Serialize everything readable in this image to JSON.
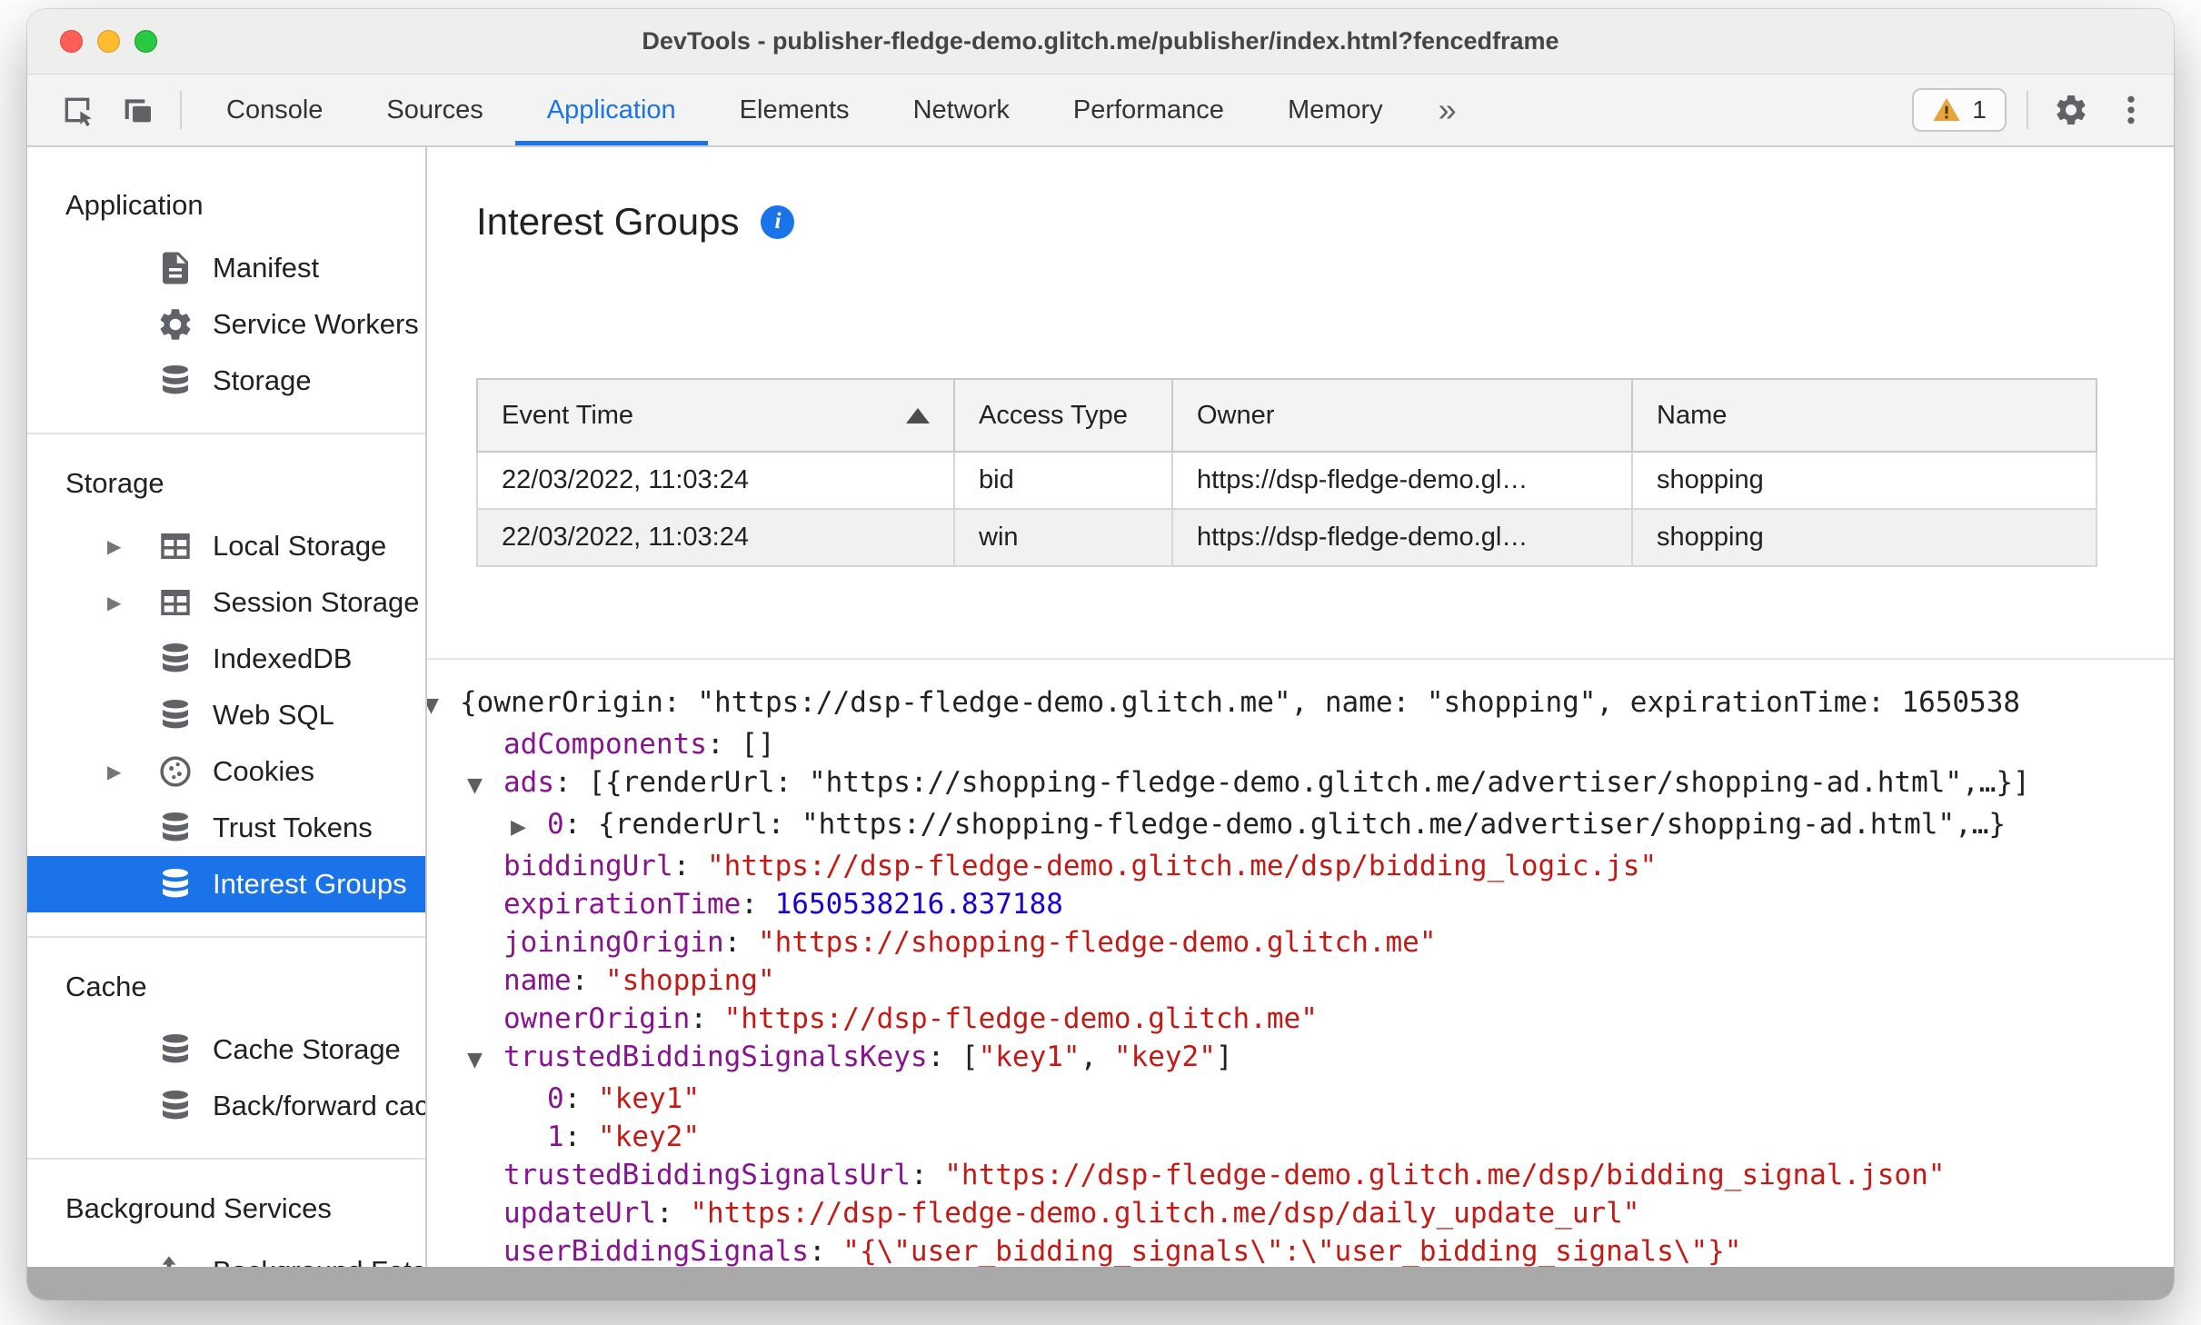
{
  "colors": {
    "accent": "#1a73e8",
    "selected_item_bg": "#1a73e8",
    "tree_key": "#881391",
    "tree_string": "#c41a16",
    "tree_number": "#1c00cf",
    "warning": "#e8a33d"
  },
  "window": {
    "title": "DevTools - publisher-fledge-demo.glitch.me/publisher/index.html?fencedframe"
  },
  "toolbar": {
    "inspect_icon": "inspect-element-icon",
    "device_icon": "device-toolbar-icon",
    "tabs": [
      {
        "label": "Console",
        "active": false
      },
      {
        "label": "Sources",
        "active": false
      },
      {
        "label": "Application",
        "active": true
      },
      {
        "label": "Elements",
        "active": false
      },
      {
        "label": "Network",
        "active": false
      },
      {
        "label": "Performance",
        "active": false
      },
      {
        "label": "Memory",
        "active": false
      }
    ],
    "more_tabs_label": "»",
    "issues_count": "1",
    "settings_icon": "gear-icon",
    "menu_icon": "kebab-menu-icon"
  },
  "sidebar": {
    "sections": [
      {
        "title": "Application",
        "items": [
          {
            "label": "Manifest",
            "icon": "document-icon",
            "expandable": false,
            "selected": false
          },
          {
            "label": "Service Workers",
            "icon": "gear-icon",
            "expandable": false,
            "selected": false
          },
          {
            "label": "Storage",
            "icon": "database-icon",
            "expandable": false,
            "selected": false
          }
        ]
      },
      {
        "title": "Storage",
        "items": [
          {
            "label": "Local Storage",
            "icon": "table-icon",
            "expandable": true,
            "selected": false
          },
          {
            "label": "Session Storage",
            "icon": "table-icon",
            "expandable": true,
            "selected": false
          },
          {
            "label": "IndexedDB",
            "icon": "database-icon",
            "expandable": false,
            "selected": false
          },
          {
            "label": "Web SQL",
            "icon": "database-icon",
            "expandable": false,
            "selected": false
          },
          {
            "label": "Cookies",
            "icon": "cookie-icon",
            "expandable": true,
            "selected": false
          },
          {
            "label": "Trust Tokens",
            "icon": "database-icon",
            "expandable": false,
            "selected": false
          },
          {
            "label": "Interest Groups",
            "icon": "database-icon",
            "expandable": false,
            "selected": true
          }
        ]
      },
      {
        "title": "Cache",
        "items": [
          {
            "label": "Cache Storage",
            "icon": "database-icon",
            "expandable": false,
            "selected": false
          },
          {
            "label": "Back/forward cach",
            "icon": "database-icon",
            "expandable": false,
            "selected": false
          }
        ]
      },
      {
        "title": "Background Services",
        "items": [
          {
            "label": "Background Fetch",
            "icon": "background-fetch-icon",
            "expandable": false,
            "selected": false
          }
        ]
      }
    ]
  },
  "main": {
    "title": "Interest Groups",
    "info_icon": "info-icon",
    "table": {
      "columns": [
        {
          "label": "Event Time",
          "sort": "asc"
        },
        {
          "label": "Access Type",
          "sort": null
        },
        {
          "label": "Owner",
          "sort": null
        },
        {
          "label": "Name",
          "sort": null
        }
      ],
      "rows": [
        [
          "22/03/2022, 11:03:24",
          "bid",
          "https://dsp-fledge-demo.gl…",
          "shopping"
        ],
        [
          "22/03/2022, 11:03:24",
          "win",
          "https://dsp-fledge-demo.gl…",
          "shopping"
        ]
      ]
    },
    "tree": {
      "lines": [
        {
          "indent": 0,
          "expander": "open",
          "segments": [
            {
              "c": "plain",
              "t": "{ownerOrigin: \"https://dsp-fledge-demo.glitch.me\", name: \"shopping\", expirationTime: 1650538"
            }
          ]
        },
        {
          "indent": 1,
          "expander": "none",
          "segments": [
            {
              "c": "key",
              "t": "adComponents"
            },
            {
              "c": "plain",
              "t": ": []"
            }
          ]
        },
        {
          "indent": 1,
          "expander": "open",
          "segments": [
            {
              "c": "key",
              "t": "ads"
            },
            {
              "c": "plain",
              "t": ": [{renderUrl: \"https://shopping-fledge-demo.glitch.me/advertiser/shopping-ad.html\",…}]"
            }
          ]
        },
        {
          "indent": 2,
          "expander": "closed",
          "segments": [
            {
              "c": "key",
              "t": "0"
            },
            {
              "c": "plain",
              "t": ": {renderUrl: \"https://shopping-fledge-demo.glitch.me/advertiser/shopping-ad.html\",…}"
            }
          ]
        },
        {
          "indent": 1,
          "expander": "none",
          "segments": [
            {
              "c": "key",
              "t": "biddingUrl"
            },
            {
              "c": "plain",
              "t": ": "
            },
            {
              "c": "string",
              "t": "\"https://dsp-fledge-demo.glitch.me/dsp/bidding_logic.js\""
            }
          ]
        },
        {
          "indent": 1,
          "expander": "none",
          "segments": [
            {
              "c": "key",
              "t": "expirationTime"
            },
            {
              "c": "plain",
              "t": ": "
            },
            {
              "c": "number",
              "t": "1650538216.837188"
            }
          ]
        },
        {
          "indent": 1,
          "expander": "none",
          "segments": [
            {
              "c": "key",
              "t": "joiningOrigin"
            },
            {
              "c": "plain",
              "t": ": "
            },
            {
              "c": "string",
              "t": "\"https://shopping-fledge-demo.glitch.me\""
            }
          ]
        },
        {
          "indent": 1,
          "expander": "none",
          "segments": [
            {
              "c": "key",
              "t": "name"
            },
            {
              "c": "plain",
              "t": ": "
            },
            {
              "c": "string",
              "t": "\"shopping\""
            }
          ]
        },
        {
          "indent": 1,
          "expander": "none",
          "segments": [
            {
              "c": "key",
              "t": "ownerOrigin"
            },
            {
              "c": "plain",
              "t": ": "
            },
            {
              "c": "string",
              "t": "\"https://dsp-fledge-demo.glitch.me\""
            }
          ]
        },
        {
          "indent": 1,
          "expander": "open",
          "segments": [
            {
              "c": "key",
              "t": "trustedBiddingSignalsKeys"
            },
            {
              "c": "plain",
              "t": ": ["
            },
            {
              "c": "string",
              "t": "\"key1\""
            },
            {
              "c": "plain",
              "t": ", "
            },
            {
              "c": "string",
              "t": "\"key2\""
            },
            {
              "c": "plain",
              "t": "]"
            }
          ]
        },
        {
          "indent": 2,
          "expander": "none",
          "segments": [
            {
              "c": "key",
              "t": "0"
            },
            {
              "c": "plain",
              "t": ": "
            },
            {
              "c": "string",
              "t": "\"key1\""
            }
          ]
        },
        {
          "indent": 2,
          "expander": "none",
          "segments": [
            {
              "c": "key",
              "t": "1"
            },
            {
              "c": "plain",
              "t": ": "
            },
            {
              "c": "string",
              "t": "\"key2\""
            }
          ]
        },
        {
          "indent": 1,
          "expander": "none",
          "segments": [
            {
              "c": "key",
              "t": "trustedBiddingSignalsUrl"
            },
            {
              "c": "plain",
              "t": ": "
            },
            {
              "c": "string",
              "t": "\"https://dsp-fledge-demo.glitch.me/dsp/bidding_signal.json\""
            }
          ]
        },
        {
          "indent": 1,
          "expander": "none",
          "segments": [
            {
              "c": "key",
              "t": "updateUrl"
            },
            {
              "c": "plain",
              "t": ": "
            },
            {
              "c": "string",
              "t": "\"https://dsp-fledge-demo.glitch.me/dsp/daily_update_url\""
            }
          ]
        },
        {
          "indent": 1,
          "expander": "none",
          "segments": [
            {
              "c": "key",
              "t": "userBiddingSignals"
            },
            {
              "c": "plain",
              "t": ": "
            },
            {
              "c": "string",
              "t": "\"{\\\"user_bidding_signals\\\":\\\"user_bidding_signals\\\"}\""
            }
          ]
        }
      ]
    }
  }
}
